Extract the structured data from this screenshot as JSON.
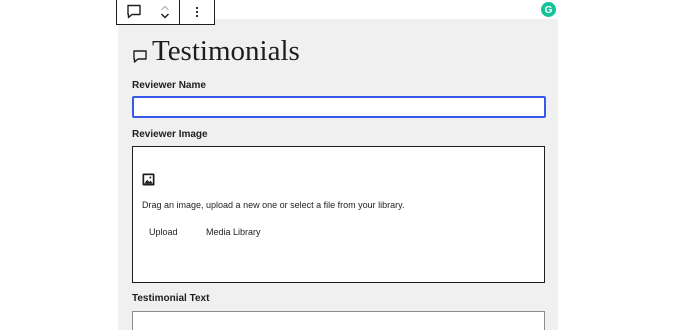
{
  "toolbar": {
    "block_icon": "comment-bubble-icon",
    "move_up_icon": "chevron-up-icon",
    "move_down_icon": "chevron-down-icon",
    "options_icon": "vertical-ellipsis-icon"
  },
  "grammarly": {
    "letter": "G",
    "color": "#15c39a"
  },
  "block": {
    "title": "Testimonials",
    "title_icon": "comment-bubble-icon",
    "reviewer_name": {
      "label": "Reviewer Name",
      "value": ""
    },
    "reviewer_image": {
      "label": "Reviewer Image",
      "icon": "image-icon",
      "instructions": "Drag an image, upload a new one or select a file from your library.",
      "upload_label": "Upload",
      "media_library_label": "Media Library"
    },
    "testimonial_text": {
      "label": "Testimonial Text",
      "value": ""
    }
  },
  "colors": {
    "focus_border": "#3858e9",
    "block_background": "#f0f0f0",
    "text": "#1e1e1e"
  }
}
